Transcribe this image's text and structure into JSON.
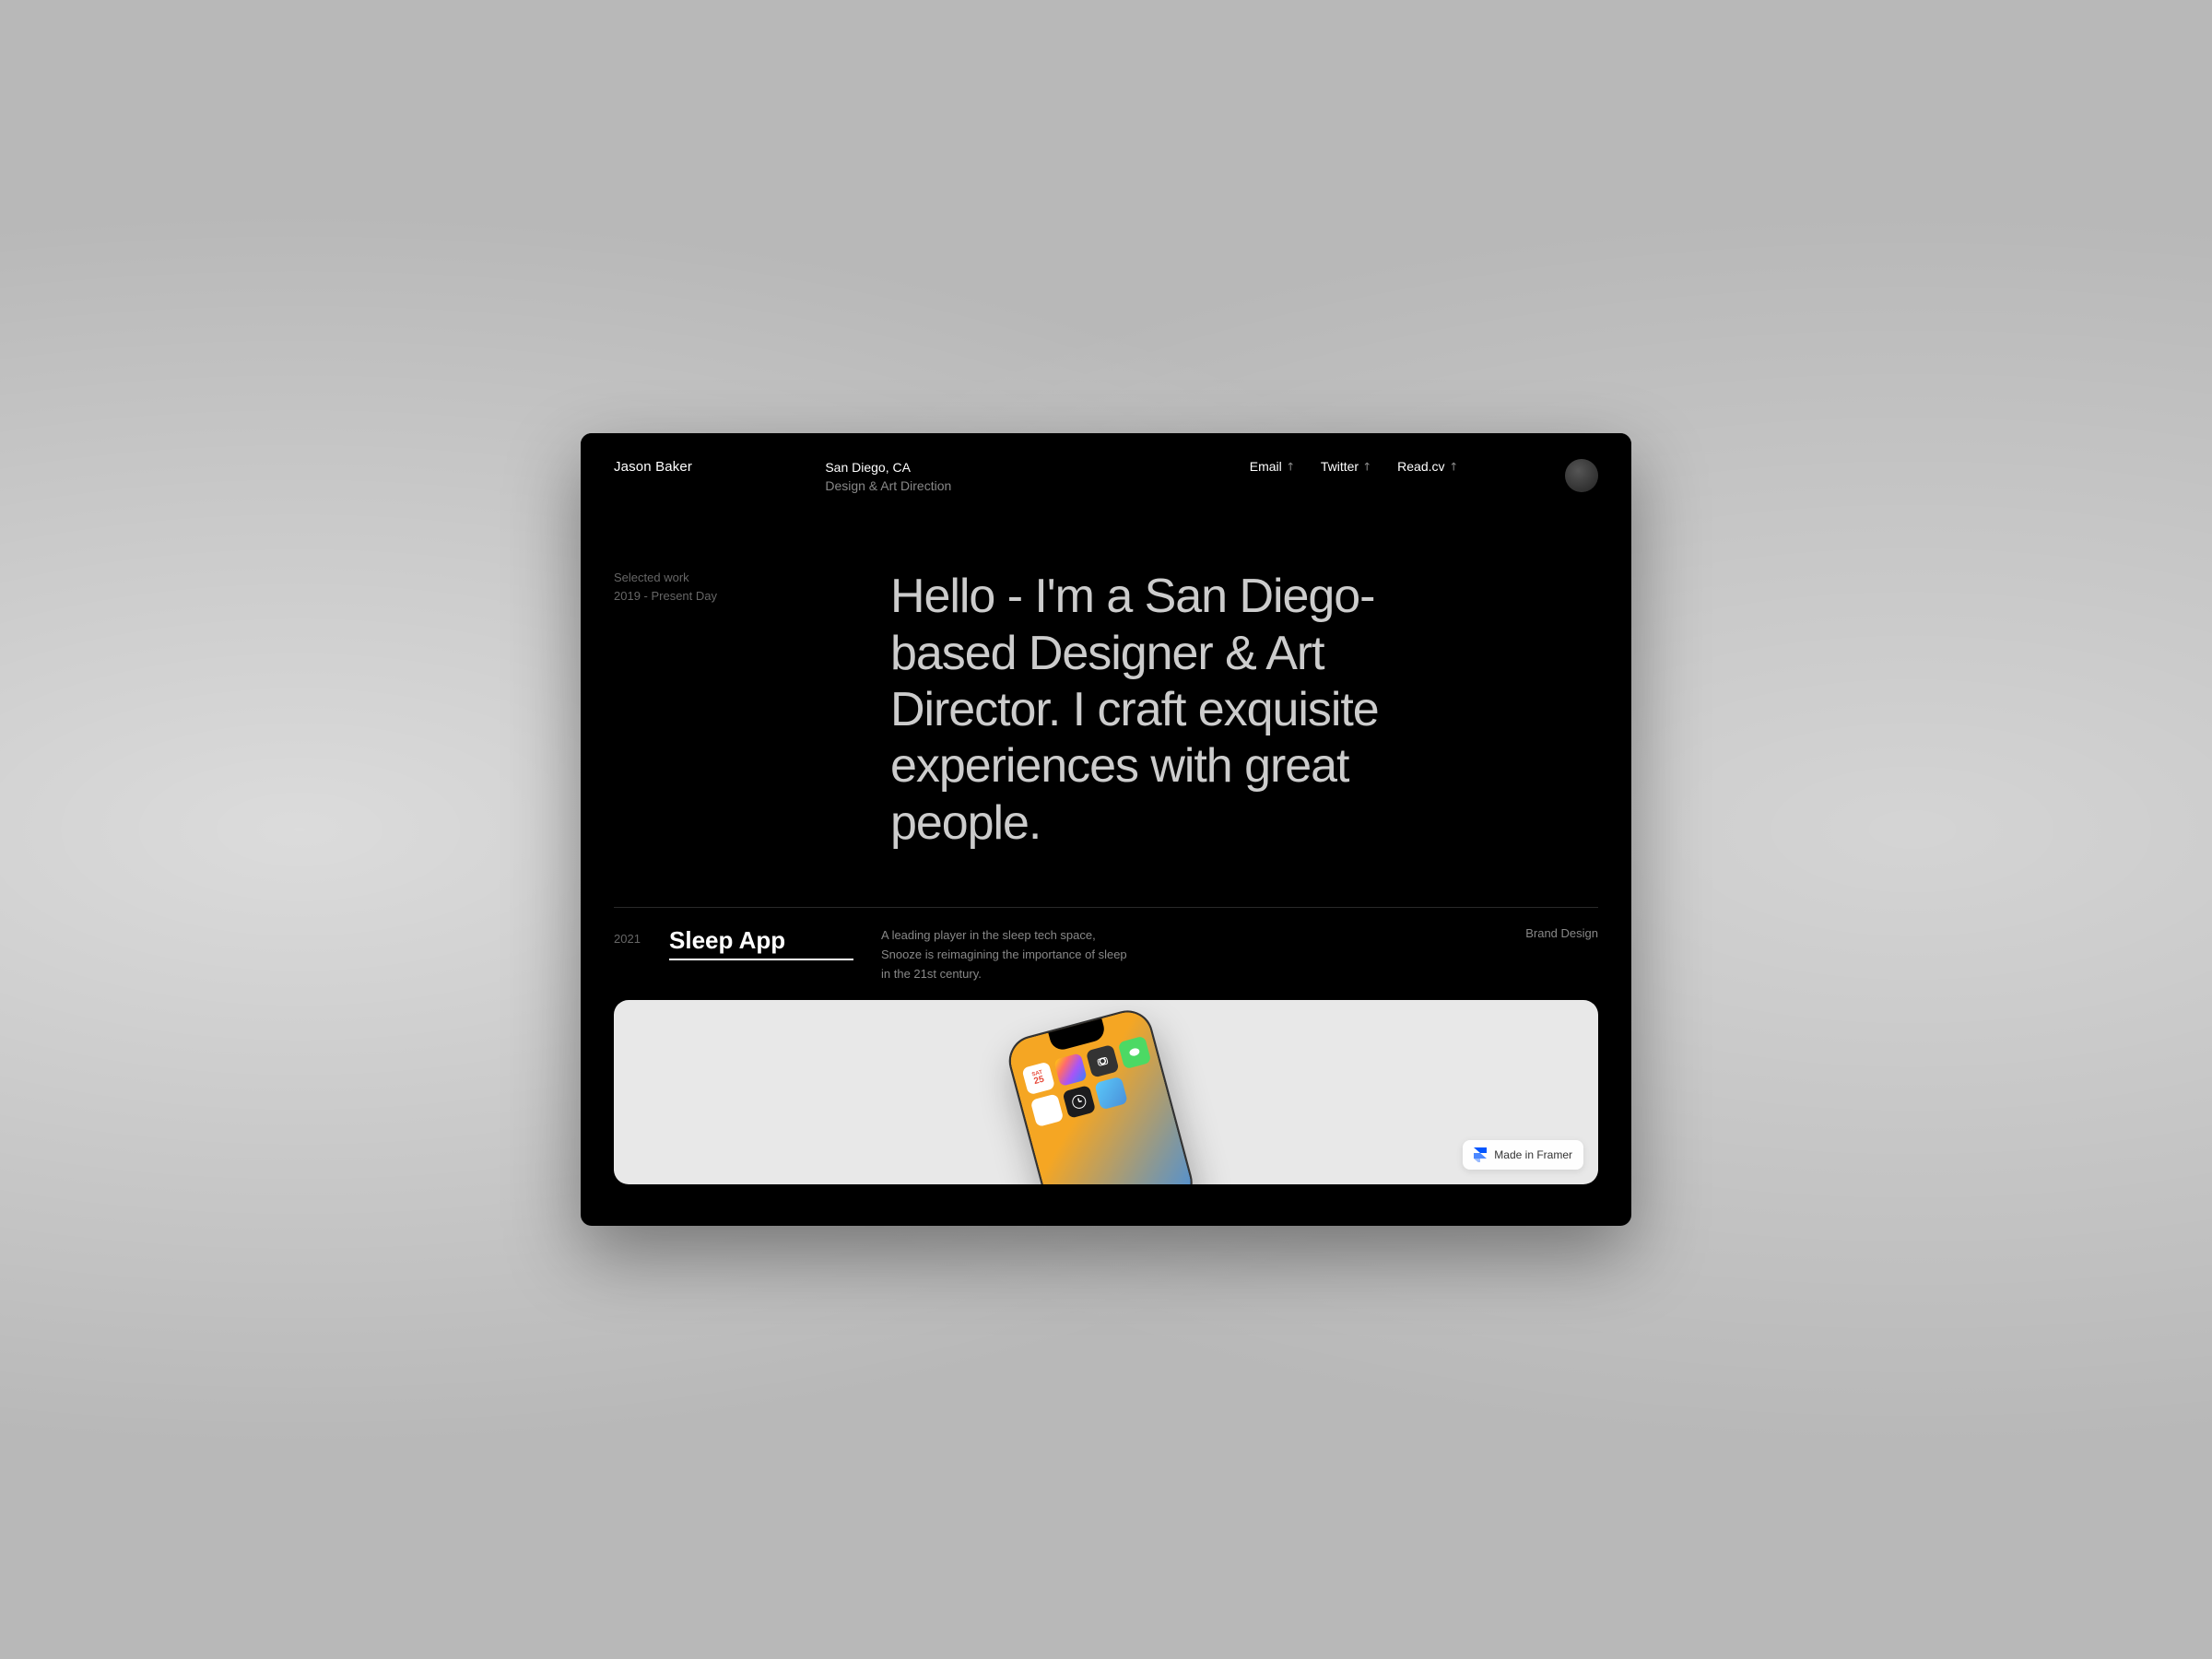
{
  "header": {
    "name": "Jason Baker",
    "location": "San Diego, CA",
    "role": "Design & Art Direction",
    "nav": {
      "email_label": "Email",
      "email_arrow": "↗",
      "twitter_label": "Twitter",
      "twitter_arrow": "↗",
      "readcv_label": "Read.cv",
      "readcv_arrow": "↗"
    }
  },
  "hero": {
    "selected_work_label": "Selected work",
    "years_label": "2019 - Present Day",
    "headline": "Hello - I'm a San Diego-based Designer & Art Director. I craft exquisite experiences with great people."
  },
  "project": {
    "year": "2021",
    "title": "Sleep App",
    "description": "A leading player in the sleep tech space, Snooze is reimagining the importance of sleep in the 21st century.",
    "category": "Brand Design"
  },
  "framer_badge": {
    "label": "Made in Framer"
  }
}
